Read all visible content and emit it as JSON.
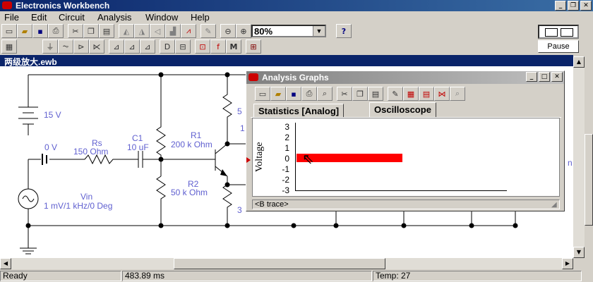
{
  "app": {
    "title": "Electronics Workbench"
  },
  "menu": [
    "File",
    "Edit",
    "Circuit",
    "Analysis",
    "Window",
    "Help"
  ],
  "toolbar": {
    "zoom": "80%",
    "help": "?",
    "pause_label": "Pause"
  },
  "document": {
    "title": "两级放大.ewb"
  },
  "circuit": {
    "battery": "15 V",
    "meter": "0 V",
    "rs_name": "Rs",
    "rs_value": "150  Ohm",
    "c1_name": "C1",
    "c1_value": "10 uF",
    "r1_name": "R1",
    "r1_value": "200 k Ohm",
    "r2_name": "R2",
    "r2_value": "50 k Ohm",
    "vin_name": "Vin",
    "vin_value": "1 mV/1 kHz/0 Deg",
    "partial_5": "5",
    "partial_1": "1",
    "partial_3": "3",
    "partial_n": "n"
  },
  "analysis": {
    "title": "Analysis Graphs",
    "tabs": [
      "Statistics [Analog]",
      "Oscilloscope"
    ],
    "active_tab": "Oscilloscope",
    "ylabel": "Voltage",
    "yticks": [
      "3",
      "2",
      "1",
      "0",
      "-1",
      "-2",
      "-3"
    ],
    "footer": "<B trace>",
    "trace_color": "#ff0000"
  },
  "status": {
    "ready": "Ready",
    "time": "483.89 ms",
    "temp": "Temp:  27"
  }
}
